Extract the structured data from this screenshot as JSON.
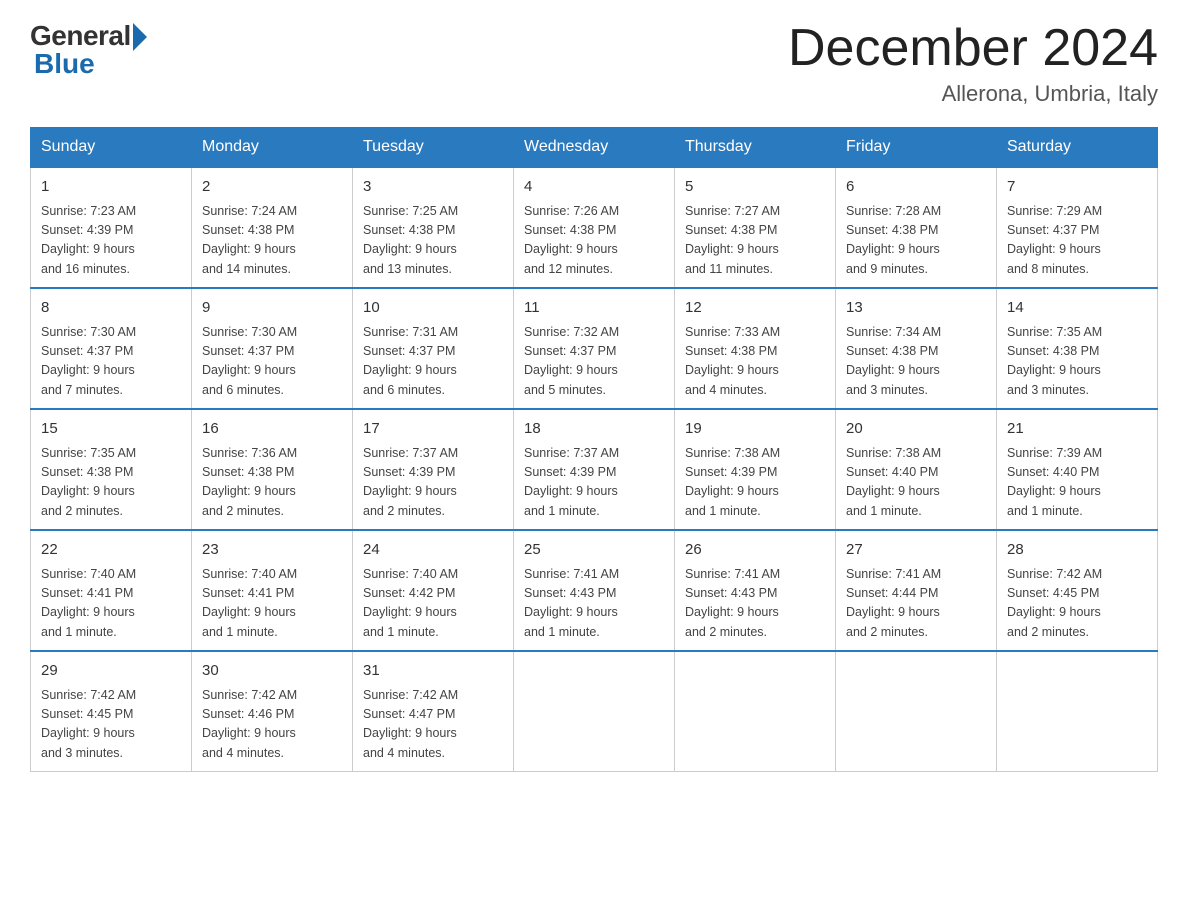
{
  "logo": {
    "general_text": "General",
    "blue_text": "Blue"
  },
  "title": "December 2024",
  "subtitle": "Allerona, Umbria, Italy",
  "weekdays": [
    "Sunday",
    "Monday",
    "Tuesday",
    "Wednesday",
    "Thursday",
    "Friday",
    "Saturday"
  ],
  "weeks": [
    [
      {
        "day": "1",
        "sunrise": "7:23 AM",
        "sunset": "4:39 PM",
        "daylight": "9 hours and 16 minutes."
      },
      {
        "day": "2",
        "sunrise": "7:24 AM",
        "sunset": "4:38 PM",
        "daylight": "9 hours and 14 minutes."
      },
      {
        "day": "3",
        "sunrise": "7:25 AM",
        "sunset": "4:38 PM",
        "daylight": "9 hours and 13 minutes."
      },
      {
        "day": "4",
        "sunrise": "7:26 AM",
        "sunset": "4:38 PM",
        "daylight": "9 hours and 12 minutes."
      },
      {
        "day": "5",
        "sunrise": "7:27 AM",
        "sunset": "4:38 PM",
        "daylight": "9 hours and 11 minutes."
      },
      {
        "day": "6",
        "sunrise": "7:28 AM",
        "sunset": "4:38 PM",
        "daylight": "9 hours and 9 minutes."
      },
      {
        "day": "7",
        "sunrise": "7:29 AM",
        "sunset": "4:37 PM",
        "daylight": "9 hours and 8 minutes."
      }
    ],
    [
      {
        "day": "8",
        "sunrise": "7:30 AM",
        "sunset": "4:37 PM",
        "daylight": "9 hours and 7 minutes."
      },
      {
        "day": "9",
        "sunrise": "7:30 AM",
        "sunset": "4:37 PM",
        "daylight": "9 hours and 6 minutes."
      },
      {
        "day": "10",
        "sunrise": "7:31 AM",
        "sunset": "4:37 PM",
        "daylight": "9 hours and 6 minutes."
      },
      {
        "day": "11",
        "sunrise": "7:32 AM",
        "sunset": "4:37 PM",
        "daylight": "9 hours and 5 minutes."
      },
      {
        "day": "12",
        "sunrise": "7:33 AM",
        "sunset": "4:38 PM",
        "daylight": "9 hours and 4 minutes."
      },
      {
        "day": "13",
        "sunrise": "7:34 AM",
        "sunset": "4:38 PM",
        "daylight": "9 hours and 3 minutes."
      },
      {
        "day": "14",
        "sunrise": "7:35 AM",
        "sunset": "4:38 PM",
        "daylight": "9 hours and 3 minutes."
      }
    ],
    [
      {
        "day": "15",
        "sunrise": "7:35 AM",
        "sunset": "4:38 PM",
        "daylight": "9 hours and 2 minutes."
      },
      {
        "day": "16",
        "sunrise": "7:36 AM",
        "sunset": "4:38 PM",
        "daylight": "9 hours and 2 minutes."
      },
      {
        "day": "17",
        "sunrise": "7:37 AM",
        "sunset": "4:39 PM",
        "daylight": "9 hours and 2 minutes."
      },
      {
        "day": "18",
        "sunrise": "7:37 AM",
        "sunset": "4:39 PM",
        "daylight": "9 hours and 1 minute."
      },
      {
        "day": "19",
        "sunrise": "7:38 AM",
        "sunset": "4:39 PM",
        "daylight": "9 hours and 1 minute."
      },
      {
        "day": "20",
        "sunrise": "7:38 AM",
        "sunset": "4:40 PM",
        "daylight": "9 hours and 1 minute."
      },
      {
        "day": "21",
        "sunrise": "7:39 AM",
        "sunset": "4:40 PM",
        "daylight": "9 hours and 1 minute."
      }
    ],
    [
      {
        "day": "22",
        "sunrise": "7:40 AM",
        "sunset": "4:41 PM",
        "daylight": "9 hours and 1 minute."
      },
      {
        "day": "23",
        "sunrise": "7:40 AM",
        "sunset": "4:41 PM",
        "daylight": "9 hours and 1 minute."
      },
      {
        "day": "24",
        "sunrise": "7:40 AM",
        "sunset": "4:42 PM",
        "daylight": "9 hours and 1 minute."
      },
      {
        "day": "25",
        "sunrise": "7:41 AM",
        "sunset": "4:43 PM",
        "daylight": "9 hours and 1 minute."
      },
      {
        "day": "26",
        "sunrise": "7:41 AM",
        "sunset": "4:43 PM",
        "daylight": "9 hours and 2 minutes."
      },
      {
        "day": "27",
        "sunrise": "7:41 AM",
        "sunset": "4:44 PM",
        "daylight": "9 hours and 2 minutes."
      },
      {
        "day": "28",
        "sunrise": "7:42 AM",
        "sunset": "4:45 PM",
        "daylight": "9 hours and 2 minutes."
      }
    ],
    [
      {
        "day": "29",
        "sunrise": "7:42 AM",
        "sunset": "4:45 PM",
        "daylight": "9 hours and 3 minutes."
      },
      {
        "day": "30",
        "sunrise": "7:42 AM",
        "sunset": "4:46 PM",
        "daylight": "9 hours and 4 minutes."
      },
      {
        "day": "31",
        "sunrise": "7:42 AM",
        "sunset": "4:47 PM",
        "daylight": "9 hours and 4 minutes."
      },
      null,
      null,
      null,
      null
    ]
  ],
  "labels": {
    "sunrise": "Sunrise:",
    "sunset": "Sunset:",
    "daylight": "Daylight:"
  }
}
